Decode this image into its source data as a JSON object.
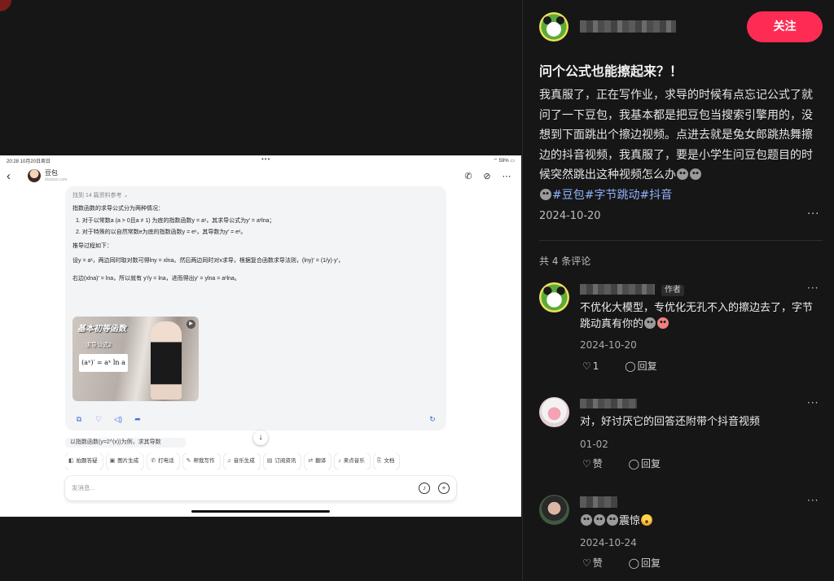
{
  "ipad": {
    "status_time": "20:28  10月20日周日",
    "status_dots": "•••",
    "status_battery": "59%",
    "bot_name": "豆包",
    "bot_domain": "doubao.com",
    "references": "找到 14 篇资料参考",
    "answer_intro": "指数函数的求导公式分为两种情况：",
    "answer_item_1": "1.  对于以常数a (a > 0且a ≠ 1) 为底的指数函数y = aˣ，其求导公式为y′ = aˣlna；",
    "answer_item_2": "2.  对于特殊的以自然常数e为底的指数函数y = eˣ，其导数为y′ = eˣ。",
    "derivation_title": "推导过程如下：",
    "derivation_line_1": "设y = aˣ，两边同时取对数可得lny = xlna。然后两边同时对x求导，根据复合函数求导法则，(lny)′ = (1/y)·y′，",
    "derivation_line_2": "右边(xlna)′ = lna，所以就有 y′/y = lna，进而得出y′ = ylna = aˣlna。",
    "video_title": "基本初等函数",
    "video_subtitle": "求导公式2",
    "video_formula": "(aˣ)′ = aˣ ln a",
    "next_snippet": "以指数函数(y=2^(x))为例，求其导数",
    "chips": [
      {
        "icon": "book-icon",
        "glyph": "◧",
        "label": "拍题答疑"
      },
      {
        "icon": "image-icon",
        "glyph": "▣",
        "label": "图片生成"
      },
      {
        "icon": "phone-icon",
        "glyph": "✆",
        "label": "打电话"
      },
      {
        "icon": "pen-icon",
        "glyph": "✎",
        "label": "帮我写作"
      },
      {
        "icon": "music-icon",
        "glyph": "♫",
        "label": "音乐生成"
      },
      {
        "icon": "news-icon",
        "glyph": "▤",
        "label": "订阅资讯"
      },
      {
        "icon": "translate-icon",
        "glyph": "⇄",
        "label": "翻译"
      },
      {
        "icon": "music-note-icon",
        "glyph": "♪",
        "label": "来点音乐"
      },
      {
        "icon": "doc-icon",
        "glyph": "⎘",
        "label": "文档"
      }
    ],
    "input_placeholder": "发消息..."
  },
  "panel": {
    "follow_label": "关注",
    "post_title": "问个公式也能擦起来？！",
    "post_text": "我真服了，正在写作业，求导的时候有点忘记公式了就问了一下豆包，我基本都是把豆包当搜索引擎用的，没想到下面跳出个擦边视频。点进去就是兔女郎跳热舞擦边的抖音视频，我真服了，要是小学生问豆包题目的时候突然跳出这种视频怎么办",
    "hashtags": [
      "#豆包",
      "#字节跳动",
      "#抖音"
    ],
    "post_date": "2024-10-20",
    "more_label": "···",
    "comment_count": "共 4 条评论",
    "comments": [
      {
        "text": "不优化大模型，专优化无孔不入的擦边去了，字节跳动真有你的",
        "date": "2024-10-20",
        "likes": "1",
        "reply_label": "回复",
        "author_tag": "作者"
      },
      {
        "text": "对，好讨厌它的回答还附带个抖音视频",
        "date": "01-02",
        "like_label": "赞",
        "reply_label": "回复"
      },
      {
        "text": "震惊",
        "date": "2024-10-24",
        "like_label": "赞",
        "reply_label": "回复"
      }
    ]
  },
  "colors": {
    "follow_button": "#fe2c55",
    "hashtag": "#8fb4ff",
    "background": "#161616"
  }
}
